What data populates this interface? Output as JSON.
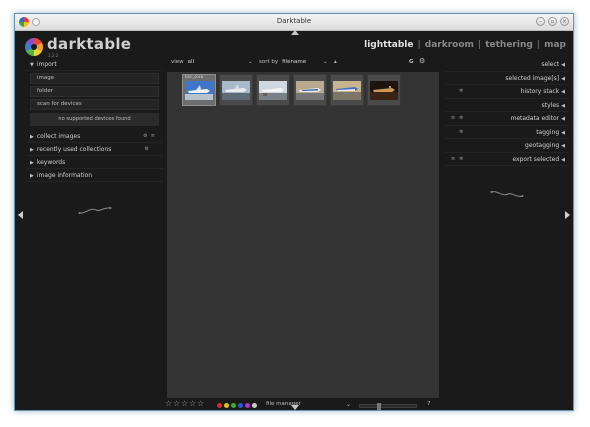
{
  "window": {
    "title": "Darktable"
  },
  "header": {
    "app_name": "darktable",
    "version": "1.2.2",
    "views": [
      "lighttable",
      "darkroom",
      "tethering",
      "map"
    ],
    "active_view": "lighttable",
    "separator": "|"
  },
  "left_panel": {
    "import": {
      "label": "import",
      "buttons": [
        "image",
        "folder",
        "scan for devices"
      ],
      "status": "no supported devices found"
    },
    "modules": [
      "collect images",
      "recently used collections",
      "keywords",
      "image information"
    ]
  },
  "center_toolbar": {
    "view_label": "view",
    "view_value": "all",
    "sort_label": "sort by",
    "sort_value": "filename",
    "sort_order": "▴",
    "grouping_label": "G",
    "dropdown_arrow": "⌄"
  },
  "thumbnails": [
    {
      "label": "DSC_0018",
      "selected": true
    },
    {
      "label": "",
      "selected": false
    },
    {
      "label": "",
      "selected": false
    },
    {
      "label": "",
      "selected": false
    },
    {
      "label": "",
      "selected": false
    },
    {
      "label": "",
      "selected": false
    }
  ],
  "right_panel": {
    "modules": [
      "select",
      "selected image[s]",
      "history stack",
      "styles",
      "metadata editor",
      "tagging",
      "geotagging",
      "export selected"
    ]
  },
  "bottom_bar": {
    "stars": [
      "☆",
      "☆",
      "☆",
      "☆",
      "☆"
    ],
    "color_labels": [
      "#d62a2a",
      "#e0c11c",
      "#2fb02f",
      "#2a55d6",
      "#b02ed0",
      "#c9c9c9"
    ],
    "layout_mode": "file manager",
    "zoom_value": "7"
  },
  "icons": {
    "settings": "gear-icon",
    "reset": "reset-icon",
    "preset": "preset-icon"
  }
}
